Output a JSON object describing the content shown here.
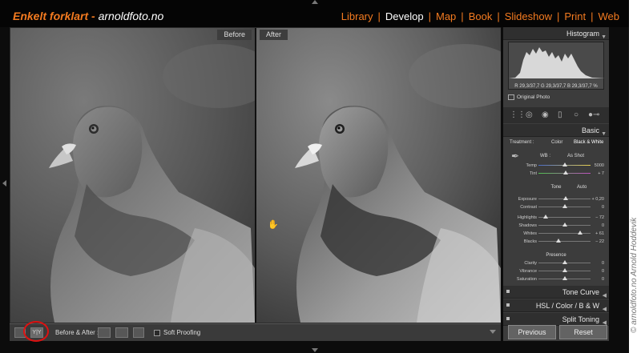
{
  "brand": {
    "name": "Enkelt forklart",
    "separator": " - ",
    "site": "arnoldfoto.no"
  },
  "modules": [
    {
      "label": "Library",
      "active": false
    },
    {
      "label": "Develop",
      "active": true
    },
    {
      "label": "Map",
      "active": false
    },
    {
      "label": "Book",
      "active": false
    },
    {
      "label": "Slideshow",
      "active": false
    },
    {
      "label": "Print",
      "active": false
    },
    {
      "label": "Web",
      "active": false
    }
  ],
  "colors": {
    "accent": "#f47b20",
    "panel": "#3c3c3c",
    "background": "#0c0c0c"
  },
  "view": {
    "before_label": "Before",
    "after_label": "After"
  },
  "toolbar": {
    "before_after_label": "Before & After :",
    "soft_proofing_label": "Soft Proofing"
  },
  "histogram": {
    "title": "Histogram",
    "readout": "R 29,3/37,7  G 29,3/37,7  B 29,3/37,7 %",
    "original_photo_label": "Original Photo"
  },
  "basic": {
    "title": "Basic",
    "treatment_label": "Treatment :",
    "treatment_color": "Color",
    "treatment_bw": "Black & White",
    "wb_label": "WB :",
    "wb_value": "As Shot",
    "tone_label": "Tone",
    "auto_label": "Auto",
    "presence_label": "Presence",
    "sliders": [
      {
        "label": "Temp",
        "value": "5000",
        "level": 0.5
      },
      {
        "label": "Tint",
        "value": "+ 7",
        "level": 0.53
      },
      {
        "label": "Exposure",
        "value": "+ 0,20",
        "level": 0.52
      },
      {
        "label": "Contrast",
        "value": "0",
        "level": 0.5
      },
      {
        "label": "Highlights",
        "value": "− 72",
        "level": 0.14
      },
      {
        "label": "Shadows",
        "value": "0",
        "level": 0.5
      },
      {
        "label": "Whites",
        "value": "+ 61",
        "level": 0.8
      },
      {
        "label": "Blacks",
        "value": "− 22",
        "level": 0.39
      },
      {
        "label": "Clarity",
        "value": "0",
        "level": 0.5
      },
      {
        "label": "Vibrance",
        "value": "0",
        "level": 0.5
      },
      {
        "label": "Saturation",
        "value": "0",
        "level": 0.5
      }
    ]
  },
  "sections": {
    "tone_curve": "Tone Curve",
    "hsl": "HSL  /  Color  /  B & W",
    "split_toning": "Split Toning"
  },
  "buttons": {
    "previous": "Previous",
    "reset": "Reset"
  },
  "watermark": "© arnoldfoto.no Arnold Hoddevik"
}
